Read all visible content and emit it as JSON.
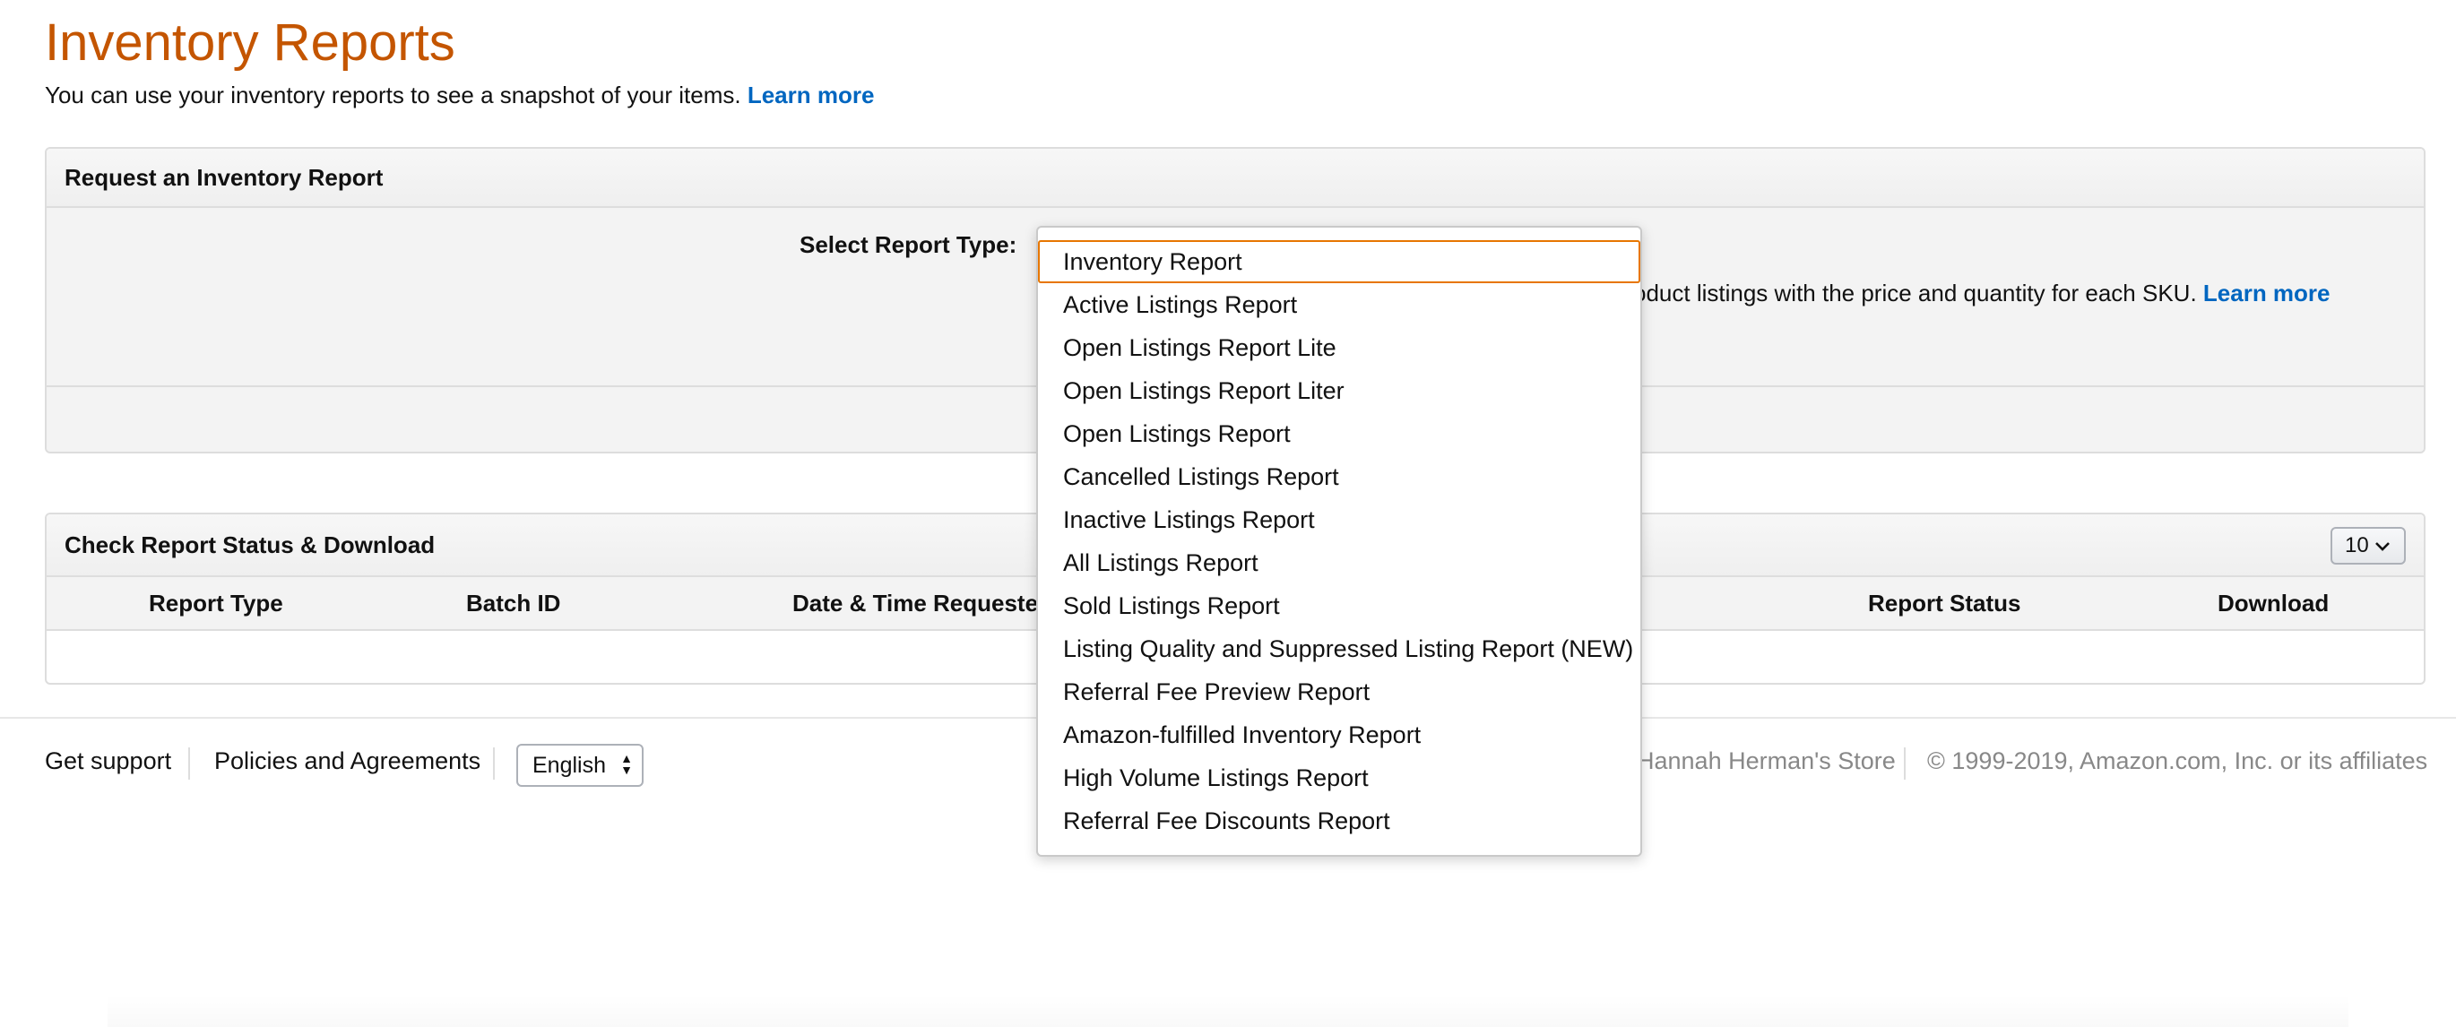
{
  "header": {
    "title": "Inventory Reports",
    "subtitle": "You can use your inventory reports to see a snapshot of your items.",
    "learn_more": "Learn more"
  },
  "request_panel": {
    "title": "Request an Inventory Report",
    "select_label": "Select Report Type:",
    "description": "oduct listings with the price and quantity for each SKU.",
    "learn_more": "Learn more"
  },
  "dropdown": {
    "selected": "Inventory Report",
    "options": [
      "Inventory Report",
      "Active Listings Report",
      "Open Listings Report Lite",
      "Open Listings Report Liter",
      "Open Listings Report",
      "Cancelled Listings Report",
      "Inactive Listings Report",
      "All Listings Report",
      "Sold Listings Report",
      "Listing Quality and Suppressed Listing Report (NEW)",
      "Referral Fee Preview Report",
      "Amazon-fulfilled Inventory Report",
      "High Volume Listings Report",
      "Referral Fee Discounts Report"
    ]
  },
  "status_panel": {
    "title": "Check Report Status & Download",
    "page_size": "10",
    "columns": [
      "Report Type",
      "Batch ID",
      "Date & Time Requested",
      "Report Status",
      "Download"
    ]
  },
  "footer": {
    "get_support": "Get support",
    "policies": "Policies and Agreements",
    "language": "English",
    "store": "Hannah Herman's Store",
    "copyright": "© 1999-2019, Amazon.com, Inc. or its affiliates"
  },
  "colors": {
    "title": "#c45500",
    "link": "#0066c0",
    "focus": "#e77600"
  }
}
